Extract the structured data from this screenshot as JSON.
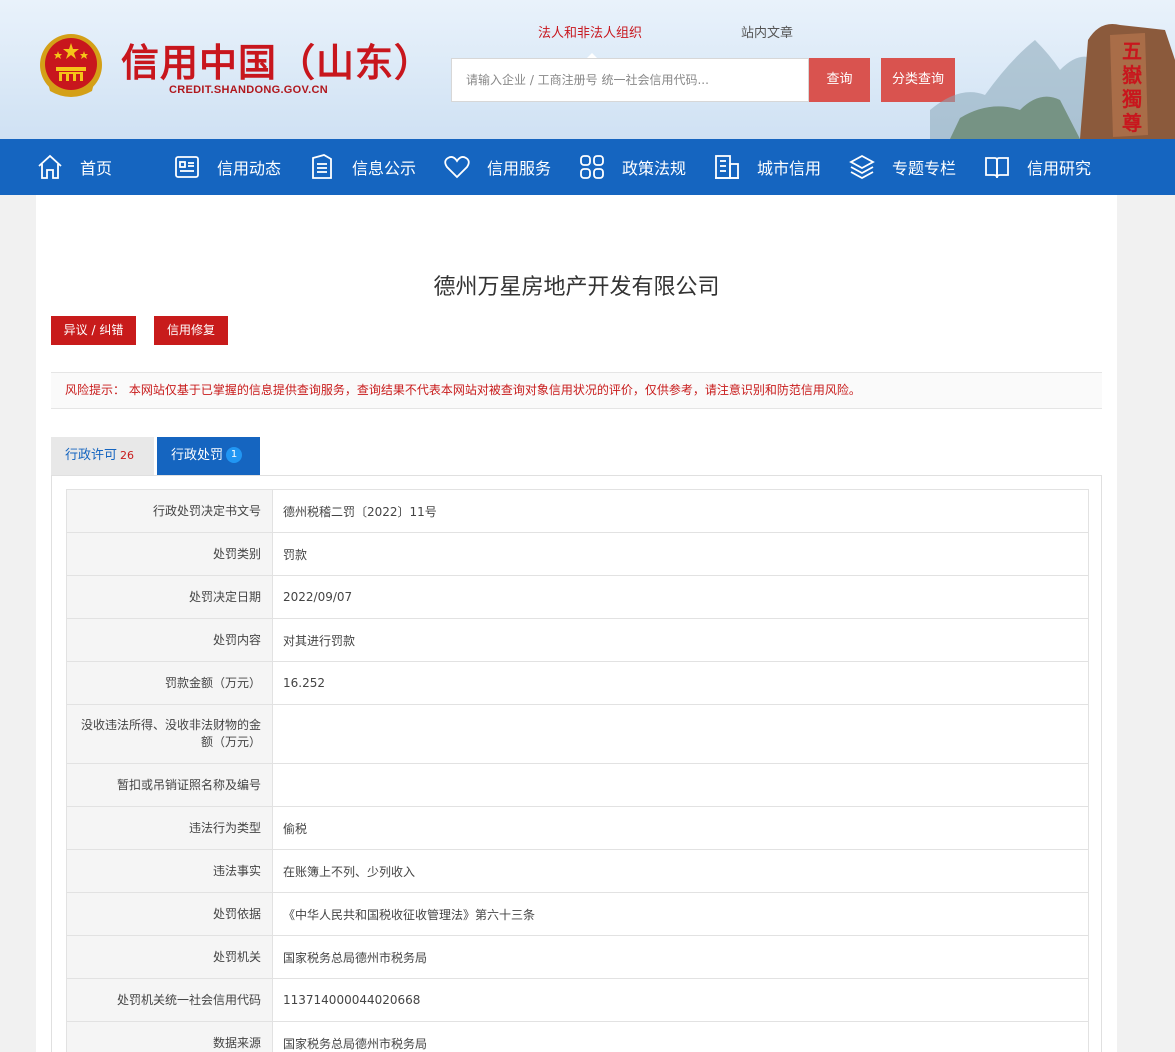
{
  "header": {
    "title": "信用中国（山东）",
    "domain": "CREDIT.SHANDONG.GOV.CN",
    "search_tabs": [
      "法人和非法人组织",
      "站内文章"
    ],
    "search_placeholder": "请输入企业 / 工商注册号 统一社会信用代码...",
    "query_button": "查询",
    "category_button": "分类查询",
    "scenery_text": "五嶽獨尊"
  },
  "nav": [
    {
      "label": "首页",
      "icon": "home-icon"
    },
    {
      "label": "信用动态",
      "icon": "news-icon"
    },
    {
      "label": "信息公示",
      "icon": "document-icon"
    },
    {
      "label": "信用服务",
      "icon": "heart-icon"
    },
    {
      "label": "政策法规",
      "icon": "grid-icon"
    },
    {
      "label": "城市信用",
      "icon": "building-icon"
    },
    {
      "label": "专题专栏",
      "icon": "layers-icon"
    },
    {
      "label": "信用研究",
      "icon": "book-icon"
    }
  ],
  "company": {
    "name": "德州万星房地产开发有限公司"
  },
  "actions": {
    "dispute": "异议 / 纠错",
    "repair": "信用修复"
  },
  "risk_notice": "风险提示： 本网站仅基于已掌握的信息提供查询服务，查询结果不代表本网站对被查询对象信用状况的评价，仅供参考，请注意识别和防范信用风险。",
  "tabs": [
    {
      "label": "行政许可",
      "count": "26"
    },
    {
      "label": "行政处罚",
      "count": "1"
    }
  ],
  "details": [
    {
      "key": "行政处罚决定书文号",
      "value": "德州税稽二罚〔2022〕11号"
    },
    {
      "key": "处罚类别",
      "value": "罚款"
    },
    {
      "key": "处罚决定日期",
      "value": "2022/09/07"
    },
    {
      "key": "处罚内容",
      "value": "对其进行罚款"
    },
    {
      "key": "罚款金额（万元）",
      "value": "16.252"
    },
    {
      "key": "没收违法所得、没收非法财物的金额（万元）",
      "value": ""
    },
    {
      "key": "暂扣或吊销证照名称及编号",
      "value": ""
    },
    {
      "key": "违法行为类型",
      "value": "偷税"
    },
    {
      "key": "违法事实",
      "value": "在账簿上不列、少列收入"
    },
    {
      "key": "处罚依据",
      "value": "《中华人民共和国税收征收管理法》第六十三条"
    },
    {
      "key": "处罚机关",
      "value": "国家税务总局德州市税务局"
    },
    {
      "key": "处罚机关统一社会信用代码",
      "value": "113714000044020668"
    },
    {
      "key": "数据来源",
      "value": "国家税务总局德州市税务局"
    }
  ]
}
